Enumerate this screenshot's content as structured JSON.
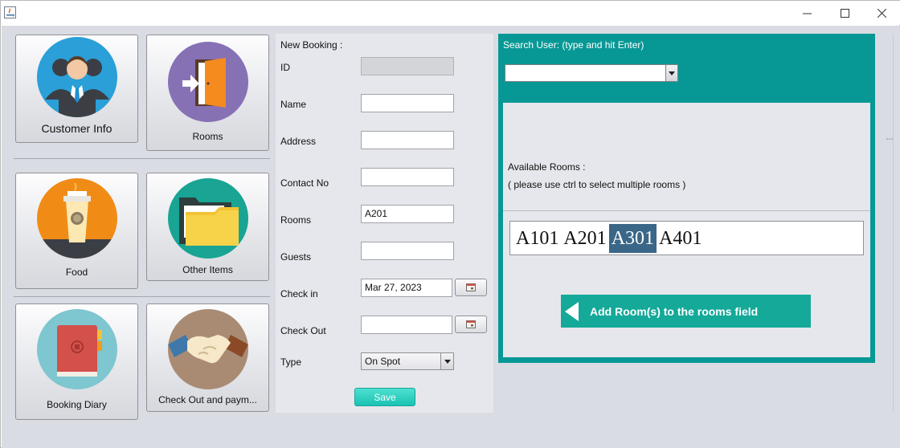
{
  "window": {
    "title": "",
    "controls": [
      "minimize-icon",
      "maximize-icon",
      "close-icon"
    ]
  },
  "tiles": [
    {
      "label": "Customer Info",
      "icon": "customers-icon",
      "color": "#2a9fd8"
    },
    {
      "label": "Rooms",
      "icon": "door-icon",
      "color": "#8671b5"
    },
    {
      "label": "Food",
      "icon": "coffee-cup-icon",
      "color": "#f08c16"
    },
    {
      "label": "Other Items",
      "icon": "folder-icon",
      "color": "#19a493"
    },
    {
      "label": "Booking Diary",
      "icon": "diary-icon",
      "color": "#7ec6d0"
    },
    {
      "label": "Check Out and paym...",
      "icon": "handshake-icon",
      "color": "#a98b74"
    }
  ],
  "form": {
    "title": "New Booking :",
    "fields": {
      "id": {
        "label": "ID",
        "value": ""
      },
      "name": {
        "label": "Name",
        "value": ""
      },
      "address": {
        "label": "Address",
        "value": ""
      },
      "contact": {
        "label": "Contact No",
        "value": ""
      },
      "rooms": {
        "label": "Rooms",
        "value": "A201"
      },
      "guests": {
        "label": "Guests",
        "value": ""
      },
      "checkin": {
        "label": "Check in",
        "value": "Mar 27, 2023"
      },
      "checkout": {
        "label": "Check Out",
        "value": ""
      },
      "type": {
        "label": "Type",
        "value": "On Spot"
      }
    },
    "save_label": "Save"
  },
  "search": {
    "label": "Search User: (type and hit Enter)",
    "value": ""
  },
  "available": {
    "label": "Available Rooms :",
    "hint": "( please use ctrl to select multiple rooms )",
    "rooms": [
      "A101",
      "A201",
      "A301",
      "A401"
    ],
    "selected": "A301"
  },
  "add_button_label": "Add Room(s) to the rooms field",
  "colors": {
    "panel": "#079895",
    "accent_button": "#14a999",
    "selection": "#3a6787",
    "save": "#19c2b2"
  }
}
